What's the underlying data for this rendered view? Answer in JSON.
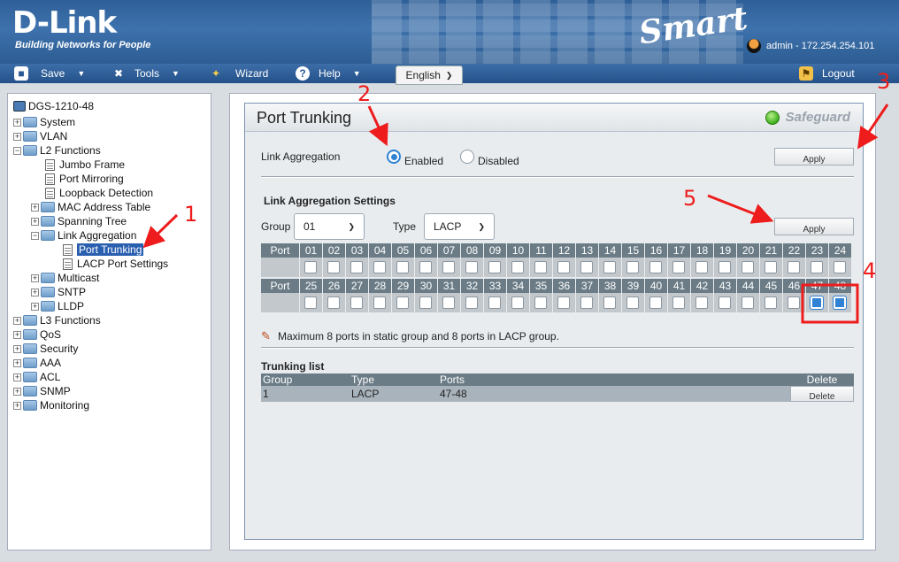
{
  "header": {
    "logo": "D-Link",
    "tagline": "Building Networks for People",
    "product": "Smart",
    "user_info": "admin - 172.254.254.101"
  },
  "menubar": {
    "items": [
      {
        "label": "Save",
        "icon": "floppy-icon"
      },
      {
        "label": "Tools",
        "icon": "tools-icon"
      },
      {
        "label": "Wizard",
        "icon": "wizard-icon"
      },
      {
        "label": "Help",
        "icon": "help-icon"
      }
    ],
    "language": "English",
    "logout": "Logout"
  },
  "tree": {
    "root": "DGS-1210-48",
    "items": [
      "System",
      "VLAN",
      "L2 Functions",
      "Jumbo Frame",
      "Port Mirroring",
      "Loopback Detection",
      "MAC Address Table",
      "Spanning Tree",
      "Link Aggregation",
      "Port Trunking",
      "LACP Port Settings",
      "Multicast",
      "SNTP",
      "LLDP",
      "L3 Functions",
      "QoS",
      "Security",
      "AAA",
      "ACL",
      "SNMP",
      "Monitoring"
    ]
  },
  "page": {
    "title": "Port Trunking",
    "safeguard": "Safeguard",
    "link_aggregation_label": "Link Aggregation",
    "enabled_label": "Enabled",
    "disabled_label": "Disabled",
    "apply_label": "Apply",
    "settings_heading": "Link Aggregation Settings",
    "group_label": "Group",
    "group_value": "01",
    "type_label": "Type",
    "type_value": "LACP",
    "port_label": "Port",
    "ports_row1": [
      "01",
      "02",
      "03",
      "04",
      "05",
      "06",
      "07",
      "08",
      "09",
      "10",
      "11",
      "12",
      "13",
      "14",
      "15",
      "16",
      "17",
      "18",
      "19",
      "20",
      "21",
      "22",
      "23",
      "24"
    ],
    "ports_row2": [
      "25",
      "26",
      "27",
      "28",
      "29",
      "30",
      "31",
      "32",
      "33",
      "34",
      "35",
      "36",
      "37",
      "38",
      "39",
      "40",
      "41",
      "42",
      "43",
      "44",
      "45",
      "46",
      "47",
      "48"
    ],
    "checked_ports": [
      "47",
      "48"
    ],
    "note": "Maximum 8 ports in static group and 8 ports in LACP group.",
    "trunking_list_heading": "Trunking list",
    "table_headers": [
      "Group",
      "Type",
      "Ports",
      "Delete"
    ],
    "table_rows": [
      {
        "group": "1",
        "type": "LACP",
        "ports": "47-48",
        "delete": "Delete"
      }
    ]
  },
  "annotations": {
    "color": "#ee1c1c",
    "numbers": [
      "1",
      "2",
      "3",
      "4",
      "5"
    ]
  }
}
